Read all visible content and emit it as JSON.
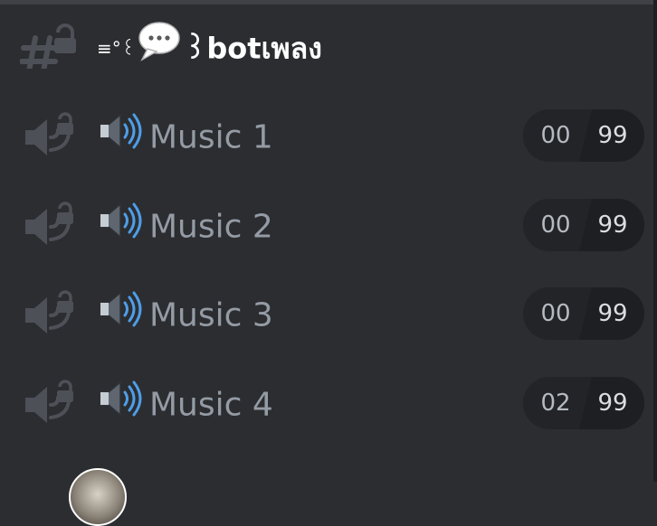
{
  "text_channel": {
    "prefix": "≡°꒰",
    "suffix": "꒱botเพลง",
    "icon": "locked-hashtag-icon",
    "emoji": "speech-bubble-icon"
  },
  "voice_channels": [
    {
      "emoji": "speaker-high-volume-icon",
      "name": "Music 1",
      "user_count": "00",
      "user_limit": "99"
    },
    {
      "emoji": "speaker-high-volume-icon",
      "name": "Music 2",
      "user_count": "00",
      "user_limit": "99"
    },
    {
      "emoji": "speaker-high-volume-icon",
      "name": "Music 3",
      "user_count": "00",
      "user_limit": "99"
    },
    {
      "emoji": "speaker-high-volume-icon",
      "name": "Music 4",
      "user_count": "02",
      "user_limit": "99"
    }
  ],
  "colors": {
    "background": "#2b2d31",
    "muted_text": "#949ba4",
    "text_channel_name": "#ffffff",
    "limit_pill": "#232428",
    "limit_pill_dark": "#1e1f22"
  }
}
